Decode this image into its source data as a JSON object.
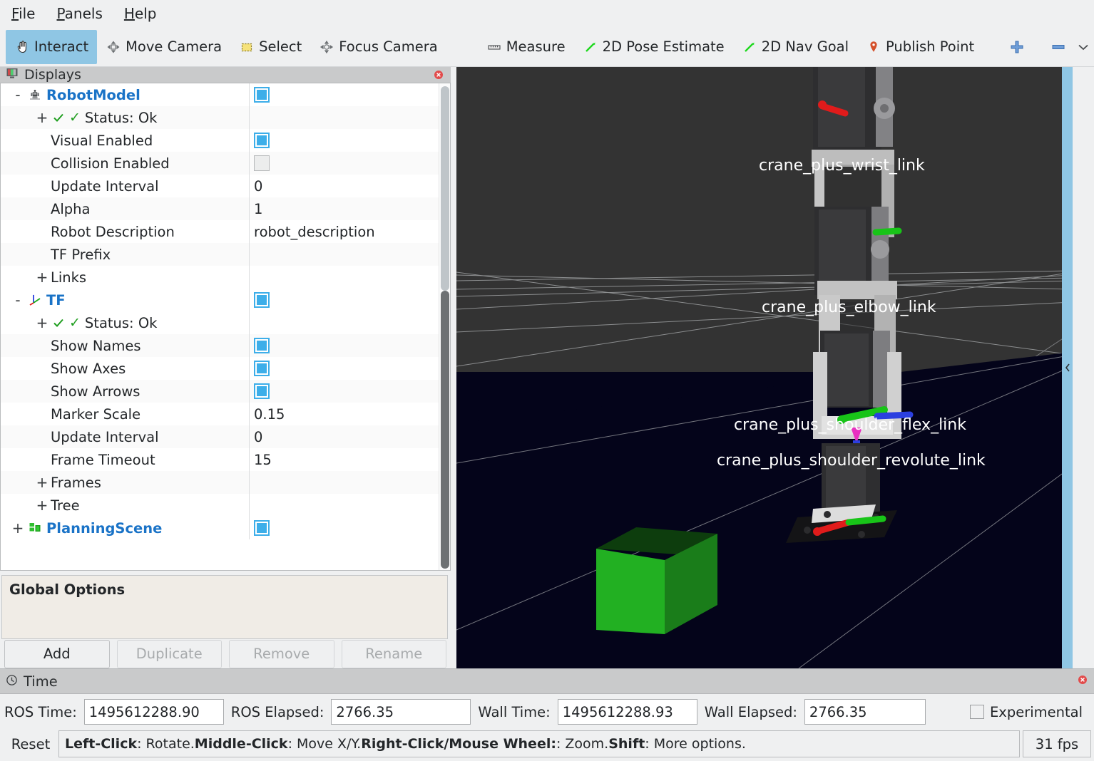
{
  "menubar": {
    "items": [
      {
        "label": "File",
        "accel": "F"
      },
      {
        "label": "Panels",
        "accel": "P"
      },
      {
        "label": "Help",
        "accel": "H"
      }
    ]
  },
  "toolbar": {
    "tools": [
      {
        "label": "Interact",
        "icon": "hand-pointer-icon",
        "active": true
      },
      {
        "label": "Move Camera",
        "icon": "move-camera-icon",
        "active": false
      },
      {
        "label": "Select",
        "icon": "select-rect-icon",
        "active": false
      },
      {
        "label": "Focus Camera",
        "icon": "focus-camera-icon",
        "active": false
      },
      {
        "label": "Measure",
        "icon": "ruler-icon",
        "active": false
      },
      {
        "label": "2D Pose Estimate",
        "icon": "pose-arrow-icon",
        "active": false
      },
      {
        "label": "2D Nav Goal",
        "icon": "nav-goal-arrow-icon",
        "active": false
      },
      {
        "label": "Publish Point",
        "icon": "map-pin-icon",
        "active": false
      }
    ],
    "add_tool_icon": "plus-icon",
    "remove_tool_icon": "minus-icon",
    "overflow_icon": "chevron-down-icon"
  },
  "displays": {
    "title": "Displays",
    "close_icon": "close-icon",
    "panel_icon": "monitor-icon",
    "rows": [
      {
        "expander": "-",
        "indent": 0,
        "icon": "robot-model-icon",
        "label": "RobotModel",
        "kind": "title",
        "value": "",
        "checkbox": "on"
      },
      {
        "expander": "+",
        "indent": 1,
        "icon": "status-ok-icon",
        "label": "Status: Ok",
        "kind": "status",
        "value": "",
        "checkbox": "none"
      },
      {
        "expander": "",
        "indent": 1,
        "icon": "",
        "label": "Visual Enabled",
        "kind": "prop",
        "value": "",
        "checkbox": "on"
      },
      {
        "expander": "",
        "indent": 1,
        "icon": "",
        "label": "Collision Enabled",
        "kind": "prop",
        "value": "",
        "checkbox": "off"
      },
      {
        "expander": "",
        "indent": 1,
        "icon": "",
        "label": "Update Interval",
        "kind": "prop",
        "value": "0",
        "checkbox": "none"
      },
      {
        "expander": "",
        "indent": 1,
        "icon": "",
        "label": "Alpha",
        "kind": "prop",
        "value": "1",
        "checkbox": "none"
      },
      {
        "expander": "",
        "indent": 1,
        "icon": "",
        "label": "Robot Description",
        "kind": "prop",
        "value": "robot_description",
        "checkbox": "none"
      },
      {
        "expander": "",
        "indent": 1,
        "icon": "",
        "label": "TF Prefix",
        "kind": "prop",
        "value": "",
        "checkbox": "none"
      },
      {
        "expander": "+",
        "indent": 1,
        "icon": "",
        "label": "Links",
        "kind": "prop",
        "value": "",
        "checkbox": "none"
      },
      {
        "expander": "-",
        "indent": 0,
        "icon": "tf-axes-icon",
        "label": "TF",
        "kind": "title",
        "value": "",
        "checkbox": "on"
      },
      {
        "expander": "+",
        "indent": 1,
        "icon": "status-ok-icon",
        "label": "Status: Ok",
        "kind": "status",
        "value": "",
        "checkbox": "none"
      },
      {
        "expander": "",
        "indent": 1,
        "icon": "",
        "label": "Show Names",
        "kind": "prop",
        "value": "",
        "checkbox": "on"
      },
      {
        "expander": "",
        "indent": 1,
        "icon": "",
        "label": "Show Axes",
        "kind": "prop",
        "value": "",
        "checkbox": "on"
      },
      {
        "expander": "",
        "indent": 1,
        "icon": "",
        "label": "Show Arrows",
        "kind": "prop",
        "value": "",
        "checkbox": "on"
      },
      {
        "expander": "",
        "indent": 1,
        "icon": "",
        "label": "Marker Scale",
        "kind": "prop",
        "value": "0.15",
        "checkbox": "none"
      },
      {
        "expander": "",
        "indent": 1,
        "icon": "",
        "label": "Update Interval",
        "kind": "prop",
        "value": "0",
        "checkbox": "none"
      },
      {
        "expander": "",
        "indent": 1,
        "icon": "",
        "label": "Frame Timeout",
        "kind": "prop",
        "value": "15",
        "checkbox": "none"
      },
      {
        "expander": "+",
        "indent": 1,
        "icon": "",
        "label": "Frames",
        "kind": "prop",
        "value": "",
        "checkbox": "none"
      },
      {
        "expander": "+",
        "indent": 1,
        "icon": "",
        "label": "Tree",
        "kind": "prop",
        "value": "",
        "checkbox": "none"
      },
      {
        "expander": "+",
        "indent": 0,
        "icon": "planning-scene-icon",
        "label": "PlanningScene",
        "kind": "title",
        "value": "",
        "checkbox": "on"
      }
    ],
    "global_options": {
      "title": "Global Options"
    },
    "buttons": [
      {
        "label": "Add",
        "enabled": true
      },
      {
        "label": "Duplicate",
        "enabled": false
      },
      {
        "label": "Remove",
        "enabled": false
      },
      {
        "label": "Rename",
        "enabled": false
      }
    ]
  },
  "view3d": {
    "left_collapse_icon": "chevron-left-icon",
    "right_collapse_icon": "chevron-left-icon",
    "background_color": "#333333",
    "floor_color": "#04041a",
    "grid_color": "#b0b0b0",
    "frame_labels": [
      "crane_plus_wrist_link",
      "crane_plus_elbow_link",
      "crane_plus_shoulder_flex_link",
      "crane_plus_shoulder_revolute_link"
    ],
    "objects": [
      {
        "name": "green-box",
        "color": "#22b022"
      }
    ]
  },
  "time": {
    "title": "Time",
    "clock_icon": "clock-icon",
    "close_icon": "close-icon",
    "fields": [
      {
        "label": "ROS Time:",
        "value": "1495612288.90"
      },
      {
        "label": "ROS Elapsed:",
        "value": "2766.35"
      },
      {
        "label": "Wall Time:",
        "value": "1495612288.93"
      },
      {
        "label": "Wall Elapsed:",
        "value": "2766.35"
      }
    ],
    "experimental_label": "Experimental",
    "experimental_checked": false
  },
  "statusbar": {
    "reset_label": "Reset",
    "hint_parts": [
      {
        "text": "Left-Click",
        "bold": true
      },
      {
        "text": ": Rotate. ",
        "bold": false
      },
      {
        "text": "Middle-Click",
        "bold": true
      },
      {
        "text": ": Move X/Y. ",
        "bold": false
      },
      {
        "text": "Right-Click/Mouse Wheel:",
        "bold": true
      },
      {
        "text": ": Zoom. ",
        "bold": false
      },
      {
        "text": "Shift",
        "bold": true
      },
      {
        "text": ": More options.",
        "bold": false
      }
    ],
    "fps": "31 fps"
  }
}
